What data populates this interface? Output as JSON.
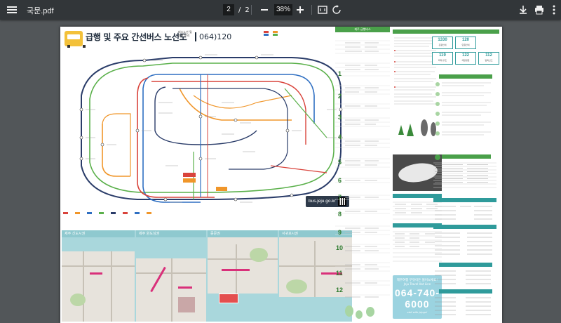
{
  "viewer": {
    "file_title": "국문.pdf",
    "current_page": "2",
    "page_separator": "/",
    "total_pages": "2",
    "zoom": "38%",
    "icons": [
      "menu-icon",
      "zoom-out-icon",
      "zoom-in-icon",
      "fit-page-icon",
      "rotate-icon",
      "download-icon",
      "print-icon",
      "more-vert-icon"
    ]
  },
  "map": {
    "title": "급행 및 주요 간선버스 노선도",
    "phone": "064)120",
    "subtitle": "버스노선 및 운행 문의",
    "url": "bus.jeju.go.kr",
    "area_maps": [
      "제주 신도시권",
      "제주 원도심권",
      "중문권",
      "서귀포시권"
    ]
  },
  "info": {
    "bus_header": "제주 급행버스",
    "route_numbers": [
      "1",
      "2",
      "3",
      "4",
      "5",
      "6",
      "7",
      "8",
      "9",
      "10",
      "11",
      "12"
    ],
    "airport_header": "제주공항",
    "phone_cards": [
      {
        "num": "1330",
        "txt": "관광안내"
      },
      {
        "num": "120",
        "txt": "민원안내"
      },
      {
        "num": "119",
        "txt": "화재·구조"
      },
      {
        "num": "122",
        "txt": "해양경찰"
      },
      {
        "num": "112",
        "txt": "범죄신고"
      }
    ],
    "hotline_l1": "제주여행 무엇이든 물어보세요!",
    "hotline_l2": "Jeju Travel Hot Line",
    "hotline_number": "064-740-6000",
    "hotline_tag": "visit with jejugo!"
  },
  "colors": {
    "accent_green": "#4aa04a",
    "teal": "#2f9b9b",
    "sea": "#a9d7dc",
    "route_red": "#d9443c",
    "route_orange": "#f0962a",
    "route_blue": "#2f6fc2",
    "route_navy": "#2a3c69",
    "route_green": "#5ab04a"
  }
}
